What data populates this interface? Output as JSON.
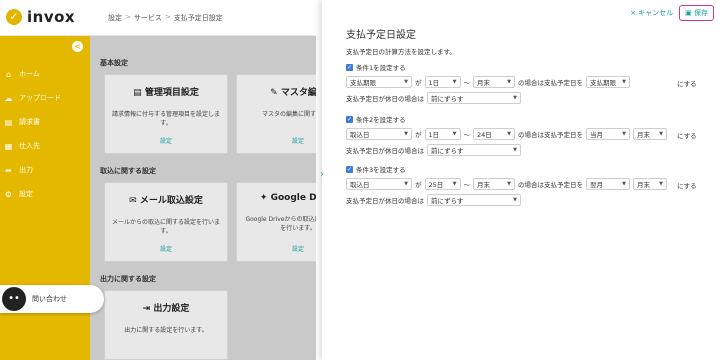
{
  "app": {
    "name": "invox",
    "logo_char": "✓"
  },
  "breadcrumb": [
    "設定",
    "サービス",
    "支払予定日設定"
  ],
  "sidebar": {
    "items": [
      {
        "label": "ホーム",
        "icon": "home-icon"
      },
      {
        "label": "アップロード",
        "icon": "upload-icon"
      },
      {
        "label": "請求書",
        "icon": "document-icon"
      },
      {
        "label": "仕入先",
        "icon": "vendor-icon"
      },
      {
        "label": "出力",
        "icon": "output-icon"
      },
      {
        "label": "設定",
        "icon": "gear-icon"
      }
    ],
    "contact_label": "問い合わせ"
  },
  "main": {
    "sections": [
      {
        "title": "基本設定",
        "cards": [
          {
            "title": "管理項目設定",
            "desc": "請求情報に付与する管理項目を設定します。",
            "link": "設定"
          },
          {
            "title": "マスタ編集",
            "desc": "マスタの編集に関する設定",
            "link": "設定"
          }
        ]
      },
      {
        "title": "取込に関する設定",
        "cards": [
          {
            "title": "メール取込設定",
            "desc": "メールからの取込に関する設定を行います。",
            "link": "設定"
          },
          {
            "title": "Google Drive",
            "desc": "Google Driveからの取込に関する設定を行います。",
            "link": "設定"
          }
        ]
      },
      {
        "title": "出力に関する設定",
        "cards": [
          {
            "title": "出力設定",
            "desc": "出力に関する設定を行います。",
            "link": ""
          }
        ]
      }
    ]
  },
  "panel": {
    "cancel_label": "キャンセル",
    "save_label": "保存",
    "title": "支払予定日設定",
    "description": "支払予定日の計算方法を設定します。",
    "text_ga": "が",
    "text_tilde": "〜",
    "text_case": "の場合は支払予定日を",
    "text_suru": "にする",
    "text_holiday": "支払予定日が休日の場合は",
    "conditions": [
      {
        "label": "条件1を設定する",
        "field": "支払期限",
        "from": "1日",
        "to": "月末",
        "month": "支払期限",
        "day": "",
        "holiday": "前にずらす"
      },
      {
        "label": "条件2を設定する",
        "field": "取込日",
        "from": "1日",
        "to": "24日",
        "month": "当月",
        "day": "月末",
        "holiday": "前にずらす"
      },
      {
        "label": "条件3を設定する",
        "field": "取込日",
        "from": "25日",
        "to": "月末",
        "month": "翌月",
        "day": "月末",
        "holiday": "前にずらす"
      }
    ]
  },
  "colors": {
    "brand": "#e5b800",
    "accent": "#1a9c9c",
    "highlight": "#e0338a"
  }
}
